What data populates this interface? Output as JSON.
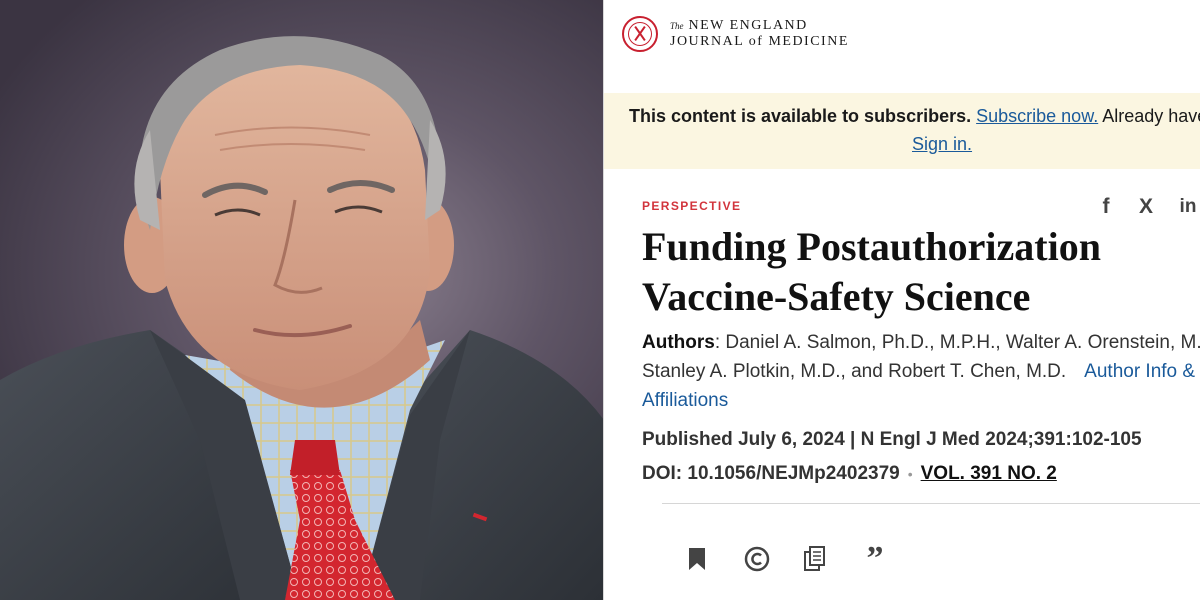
{
  "photo": {
    "subject": "portrait-photo"
  },
  "header": {
    "logo_the": "The",
    "logo_line1": "NEW ENGLAND",
    "logo_line2_pre": "JOURNAL",
    "logo_line2_of": "of",
    "logo_line2_post": "MEDICINE"
  },
  "banner": {
    "message": "This content is available to subscribers.",
    "subscribe_link": "Subscribe now.",
    "already": "Already have an ac",
    "signin_link": "Sign in."
  },
  "article": {
    "kicker": "PERSPECTIVE",
    "title_line1": "Funding Postauthorization",
    "title_line2": "Vaccine-Safety Science",
    "authors_label": "Authors",
    "authors_line1": ": Daniel A. Salmon, Ph.D., M.P.H., Walter A. Orenstein, M.D",
    "authors_line2": "Stanley A. Plotkin, M.D., and Robert T. Chen, M.D.",
    "author_info_link": "Author Info &",
    "author_info_link2": "Affiliations",
    "published": "Published July 6, 2024 | N Engl J Med 2024;391:102-105",
    "doi": "DOI: 10.1056/NEJMp2402379",
    "doi_separator": "•",
    "volume_link": "VOL. 391 NO. 2"
  },
  "share": {
    "facebook": "f",
    "x": "X",
    "linkedin": "in"
  },
  "tools": {
    "quote": "”"
  },
  "icons": [
    "facebook-icon",
    "x-icon",
    "linkedin-icon",
    "bookmark-icon",
    "copyright-icon",
    "copy-icon",
    "quote-icon"
  ],
  "colors": {
    "kicker": "#d2343c",
    "link": "#1a5a9a",
    "banner_bg": "#fbf6e1",
    "seal": "#c8202f"
  }
}
